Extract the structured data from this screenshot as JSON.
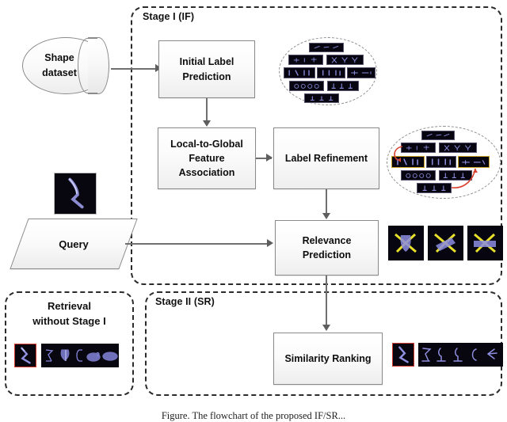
{
  "figure": {
    "caption": "Figure. The flowchart of the proposed IF/SR..."
  },
  "stages": [
    {
      "id": "stage1",
      "label": "Stage I (IF)"
    },
    {
      "id": "stage2",
      "label": "Stage II (SR)"
    },
    {
      "id": "baseline",
      "label_line1": "Retrieval",
      "label_line2": "without Stage I"
    }
  ],
  "nodes": {
    "dataset": {
      "label_line1": "Shape",
      "label_line2": "dataset",
      "shape": "cylinder"
    },
    "initial_label_prediction": {
      "label_line1": "Initial Label",
      "label_line2": "Prediction",
      "shape": "process"
    },
    "local_to_global": {
      "label_line1": "Local-to-Global",
      "label_line2": "Feature",
      "label_line3": "Association",
      "shape": "process"
    },
    "label_refinement": {
      "label": "Label Refinement",
      "shape": "process"
    },
    "relevance_prediction": {
      "label_line1": "Relevance",
      "label_line2": "Prediction",
      "shape": "process"
    },
    "query": {
      "label": "Query",
      "shape": "parallelogram"
    },
    "similarity_ranking": {
      "label": "Similarity Ranking",
      "shape": "process"
    }
  },
  "illustrations": {
    "cluster_initial": {
      "name": "initial-label-cluster",
      "rows": 5,
      "tiles": 9
    },
    "cluster_refined": {
      "name": "refined-label-cluster",
      "rows": 5,
      "tiles": 9,
      "has_refinement_arrows": true
    },
    "relevance_tiles": {
      "name": "relevance-overlay-tiles",
      "count": 3
    },
    "query_thumbnail": {
      "name": "query-shape-thumbnail"
    },
    "baseline_results": {
      "name": "baseline-ranked-results",
      "count": 5
    },
    "stage2_results": {
      "name": "stage2-ranked-results",
      "count": 5
    }
  },
  "colors": {
    "stage_border": "#2b2b2b",
    "box_border": "#8a8a8a",
    "connector": "#6f6f6f",
    "query_highlight": "#d63b2f",
    "refinement_arrow": "#d9402f",
    "overlay_accent": "#e8e02a",
    "shape_fill": "#7f7fd5",
    "thumbnail_bg": "#08070f",
    "gold_highlight": "#c9a227"
  }
}
